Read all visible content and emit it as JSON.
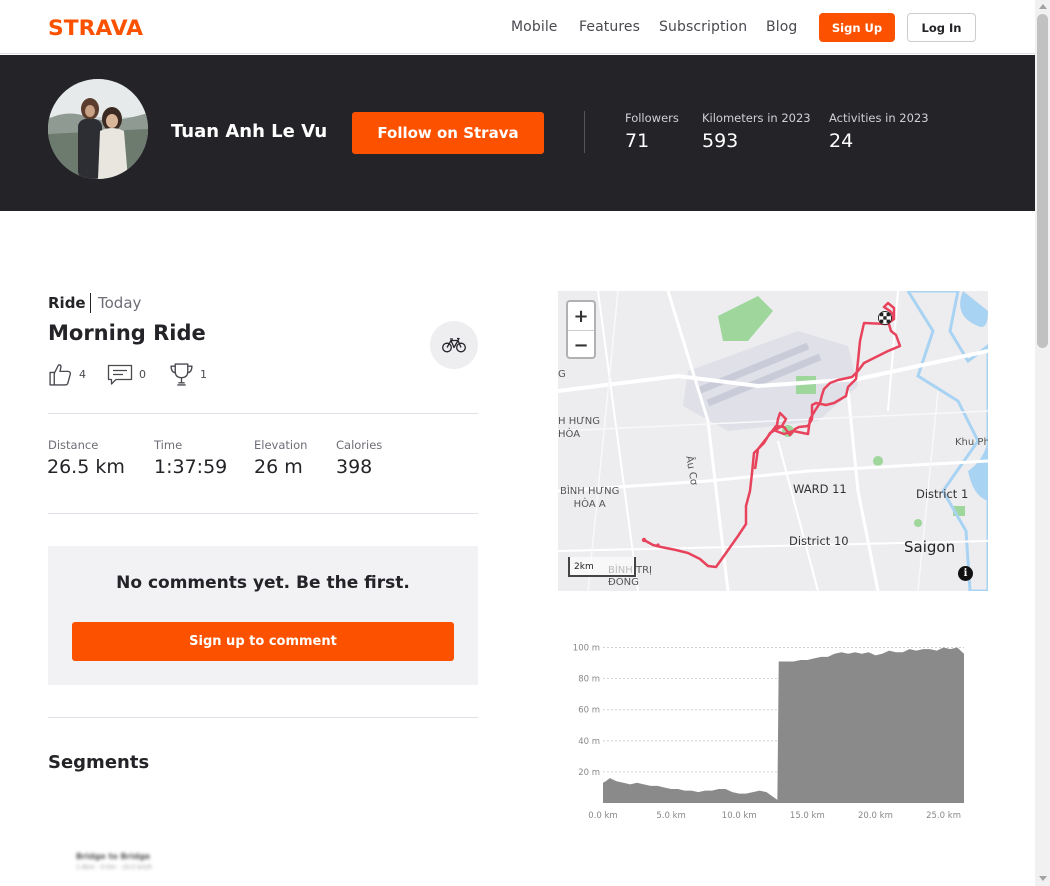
{
  "nav": {
    "brand": "STRAVA",
    "links": [
      "Mobile",
      "Features",
      "Subscription",
      "Blog"
    ],
    "signup_label": "Sign Up",
    "login_label": "Log In"
  },
  "athlete": {
    "name": "Tuan Anh Le Vu",
    "follow_label": "Follow on Strava",
    "stats": [
      {
        "label": "Followers",
        "value": "71"
      },
      {
        "label": "Kilometers in 2023",
        "value": "593"
      },
      {
        "label": "Activities in 2023",
        "value": "24"
      }
    ]
  },
  "activity": {
    "type": "Ride",
    "date": "Today",
    "title": "Morning Ride",
    "sport_icon": "bike-icon",
    "kudos": "4",
    "comments": "0",
    "achievements": "1",
    "metrics": [
      {
        "label": "Distance",
        "value": "26.5 km"
      },
      {
        "label": "Time",
        "value": "1:37:59"
      },
      {
        "label": "Elevation",
        "value": "26 m"
      },
      {
        "label": "Calories",
        "value": "398"
      }
    ]
  },
  "comments": {
    "empty_text": "No comments yet. Be the first.",
    "signup_label": "Sign up to comment"
  },
  "segments": {
    "title": "Segments",
    "first_name": "Bridge to Bridge",
    "first_meta": "1.6km · 0.0m · 19.5 km/h"
  },
  "map": {
    "zoom_in": "+",
    "zoom_out": "−",
    "scale": "2km",
    "info": "i",
    "labels": {
      "hung_hoa": "H HƯNG\nHÒA",
      "binh_hung_hoa_a": "BÌNH HƯNG\nHÒA A",
      "au_co": "Âu Cơ",
      "ward11": "WARD 11",
      "district1": "District 1",
      "district10": "District 10",
      "saigon": "Saigon",
      "khu_pho": "Khu Ph",
      "binh_tri_dong": "BÌNH TRỊ\nĐÔNG",
      "edge_g": "G"
    },
    "route_color": "#e8435c",
    "start_color": "#fc5200"
  },
  "chart_data": {
    "type": "area",
    "title": "",
    "xlabel": "",
    "ylabel": "",
    "x_ticks": [
      "0.0 km",
      "5.0 km",
      "10.0 km",
      "15.0 km",
      "20.0 km",
      "25.0 km"
    ],
    "y_ticks": [
      "20 m",
      "40 m",
      "60 m",
      "80 m",
      "100 m"
    ],
    "xlim": [
      0,
      26.5
    ],
    "ylim": [
      0,
      110
    ],
    "grid": true,
    "color": "#8a8a8a",
    "series": [
      {
        "x": [
          0,
          0.2,
          0.5,
          1,
          1.5,
          2,
          2.5,
          3,
          3.5,
          4,
          4.5,
          5,
          5.5,
          6,
          6.5,
          7,
          7.5,
          8,
          8.5,
          9,
          9.5,
          10,
          10.5,
          11,
          11.5,
          12,
          12.8,
          12.9,
          13.5,
          14,
          14.5,
          15,
          15.5,
          16,
          16.5,
          17,
          17.5,
          18,
          18.5,
          19,
          19.5,
          20,
          20.5,
          21,
          21.5,
          22,
          22.5,
          23,
          23.5,
          24,
          24.5,
          25,
          25.5,
          26,
          26.5
        ],
        "y": [
          13,
          14,
          16,
          14,
          13,
          12,
          13,
          12,
          11,
          11,
          10,
          9,
          9,
          8,
          8,
          7,
          8,
          8,
          9,
          9,
          7,
          6,
          6,
          7,
          8,
          7,
          2,
          91,
          91,
          91,
          92,
          92,
          93,
          94,
          94,
          96,
          97,
          96,
          97,
          96,
          97,
          95,
          96,
          98,
          97,
          97,
          99,
          98,
          99,
          99,
          98,
          100,
          99,
          100,
          96
        ]
      }
    ]
  }
}
